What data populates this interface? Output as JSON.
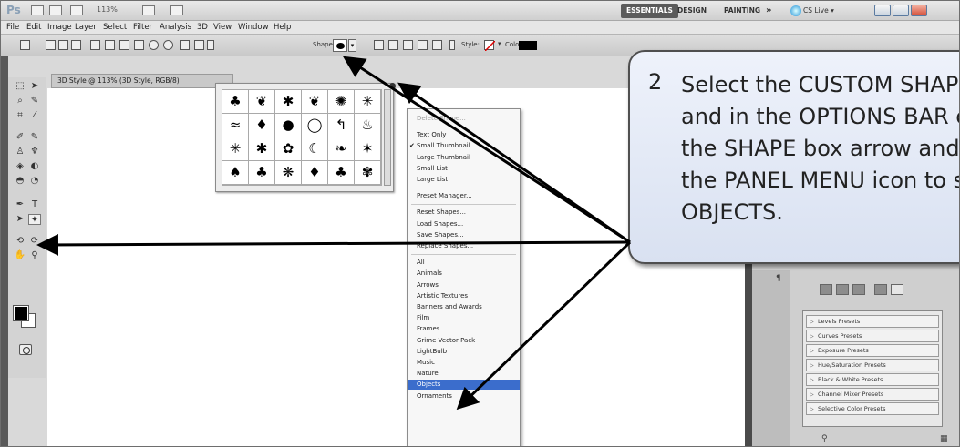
{
  "app": {
    "logo": "Ps",
    "zoom": "113%",
    "workspaces": [
      "ESSENTIALS",
      "DESIGN",
      "PAINTING",
      "»"
    ],
    "cs_live": "CS Live ▾"
  },
  "menubar": [
    "File",
    "Edit",
    "Image",
    "Layer",
    "Select",
    "Filter",
    "Analysis",
    "3D",
    "View",
    "Window",
    "Help"
  ],
  "options_bar": {
    "shape_label": "Shape:",
    "style_label": "Style:",
    "color_label": "Color:",
    "accent_color": "#000000"
  },
  "document": {
    "tab_title": "3D Style @ 113% (3D Style, RGB/8)"
  },
  "shape_picker": {
    "shapes": [
      "♣",
      "❦",
      "✱",
      "❦",
      "✺",
      "✳",
      "≈",
      "♦",
      "●",
      "◯",
      "↰",
      "♨",
      "✳",
      "✱",
      "✿",
      "☾",
      "❧",
      "✶",
      "♠",
      "♣",
      "❋",
      "♦",
      "♣",
      "✾"
    ]
  },
  "panel_menu": {
    "items": [
      {
        "label": "Delete Shape...",
        "state": "disabled"
      },
      {
        "sep": true
      },
      {
        "label": "Text Only"
      },
      {
        "label": "Small Thumbnail",
        "check": "✔"
      },
      {
        "label": "Large Thumbnail"
      },
      {
        "label": "Small List"
      },
      {
        "label": "Large List"
      },
      {
        "sep": true
      },
      {
        "label": "Preset Manager..."
      },
      {
        "sep": true
      },
      {
        "label": "Reset Shapes..."
      },
      {
        "label": "Load Shapes..."
      },
      {
        "label": "Save Shapes..."
      },
      {
        "label": "Replace Shapes..."
      },
      {
        "sep": true
      },
      {
        "label": "All"
      },
      {
        "label": "Animals"
      },
      {
        "label": "Arrows"
      },
      {
        "label": "Artistic Textures"
      },
      {
        "label": "Banners and Awards"
      },
      {
        "label": "Film"
      },
      {
        "label": "Frames"
      },
      {
        "label": "Grime Vector Pack"
      },
      {
        "label": "LightBulb"
      },
      {
        "label": "Music"
      },
      {
        "label": "Nature"
      },
      {
        "label": "Objects",
        "state": "selected"
      },
      {
        "label": "Ornaments"
      }
    ]
  },
  "right_panel": {
    "paragraph_icon": "¶",
    "presets": [
      "Levels Presets",
      "Curves Presets",
      "Exposure Presets",
      "Hue/Saturation Presets",
      "Black & White Presets",
      "Channel Mixer Presets",
      "Selective Color Presets"
    ]
  },
  "callout": {
    "number": "2",
    "text": "Select the CUSTOM SHAPE TOOL\nand in the OPTIONS BAR click\nthe SHAPE box arrow and click\nthe PANEL MENU icon to select\nOBJECTS."
  }
}
